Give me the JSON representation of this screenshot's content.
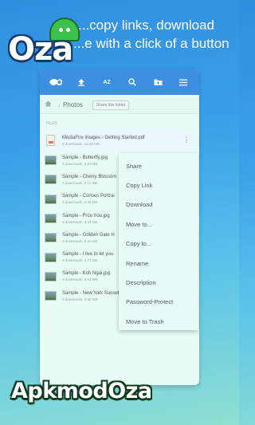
{
  "banner": {
    "line1": "...copy links, download",
    "line2": "...e with a click of a button"
  },
  "logo": {
    "text": "Oza"
  },
  "toolbar": {
    "icons": [
      "mediafire-logo-icon",
      "upload-icon",
      "sort-az-icon",
      "search-icon",
      "new-folder-icon",
      "menu-icon"
    ],
    "sort_label": "AZ"
  },
  "breadcrumb": {
    "folder": "Photos",
    "share_button": "Share this folder"
  },
  "section_label": "FILES",
  "files": [
    {
      "name": "MediaFire Images - Getting Started.pdf",
      "meta": "0 downloads, 12.43 MB",
      "type": "pdf"
    },
    {
      "name": "Sample - Butterfly.jpg",
      "meta": "0 downloads, 6.61 MB",
      "type": "img"
    },
    {
      "name": "Sample - Cherry Blossom",
      "meta": "0 downloads, 2.11 MB",
      "type": "img"
    },
    {
      "name": "Sample - Curious Portrai",
      "meta": "0 downloads, 3.36 MB",
      "type": "img"
    },
    {
      "name": "Sample - Frou frou.jpg",
      "meta": "0 downloads, 3.47 MB",
      "type": "img"
    },
    {
      "name": "Sample - Golden Gate H",
      "meta": "0 downloads, 8.45 MB",
      "type": "img"
    },
    {
      "name": "Sample - I live to let you",
      "meta": "0 downloads, 1.72 MB",
      "type": "img"
    },
    {
      "name": "Sample - Koh Ngai.jpg",
      "meta": "0 downloads, 6.91 MB",
      "type": "img"
    },
    {
      "name": "Sample - New York Sunset - HDR.jpg",
      "meta": "0 downloads, 3.80 MB",
      "type": "img"
    }
  ],
  "context_menu": {
    "items": [
      "Share",
      "Copy Link",
      "Download",
      "Move to...",
      "Copy to...",
      "Rename",
      "Description",
      "Password-Protect",
      "Move to Trash"
    ]
  },
  "watermark": {
    "text": "ApkmodOza"
  },
  "colors": {
    "toolbar": "#3d8fe2",
    "screen_background": "#e8fbf5",
    "menu_background": "#e9fbf7"
  }
}
